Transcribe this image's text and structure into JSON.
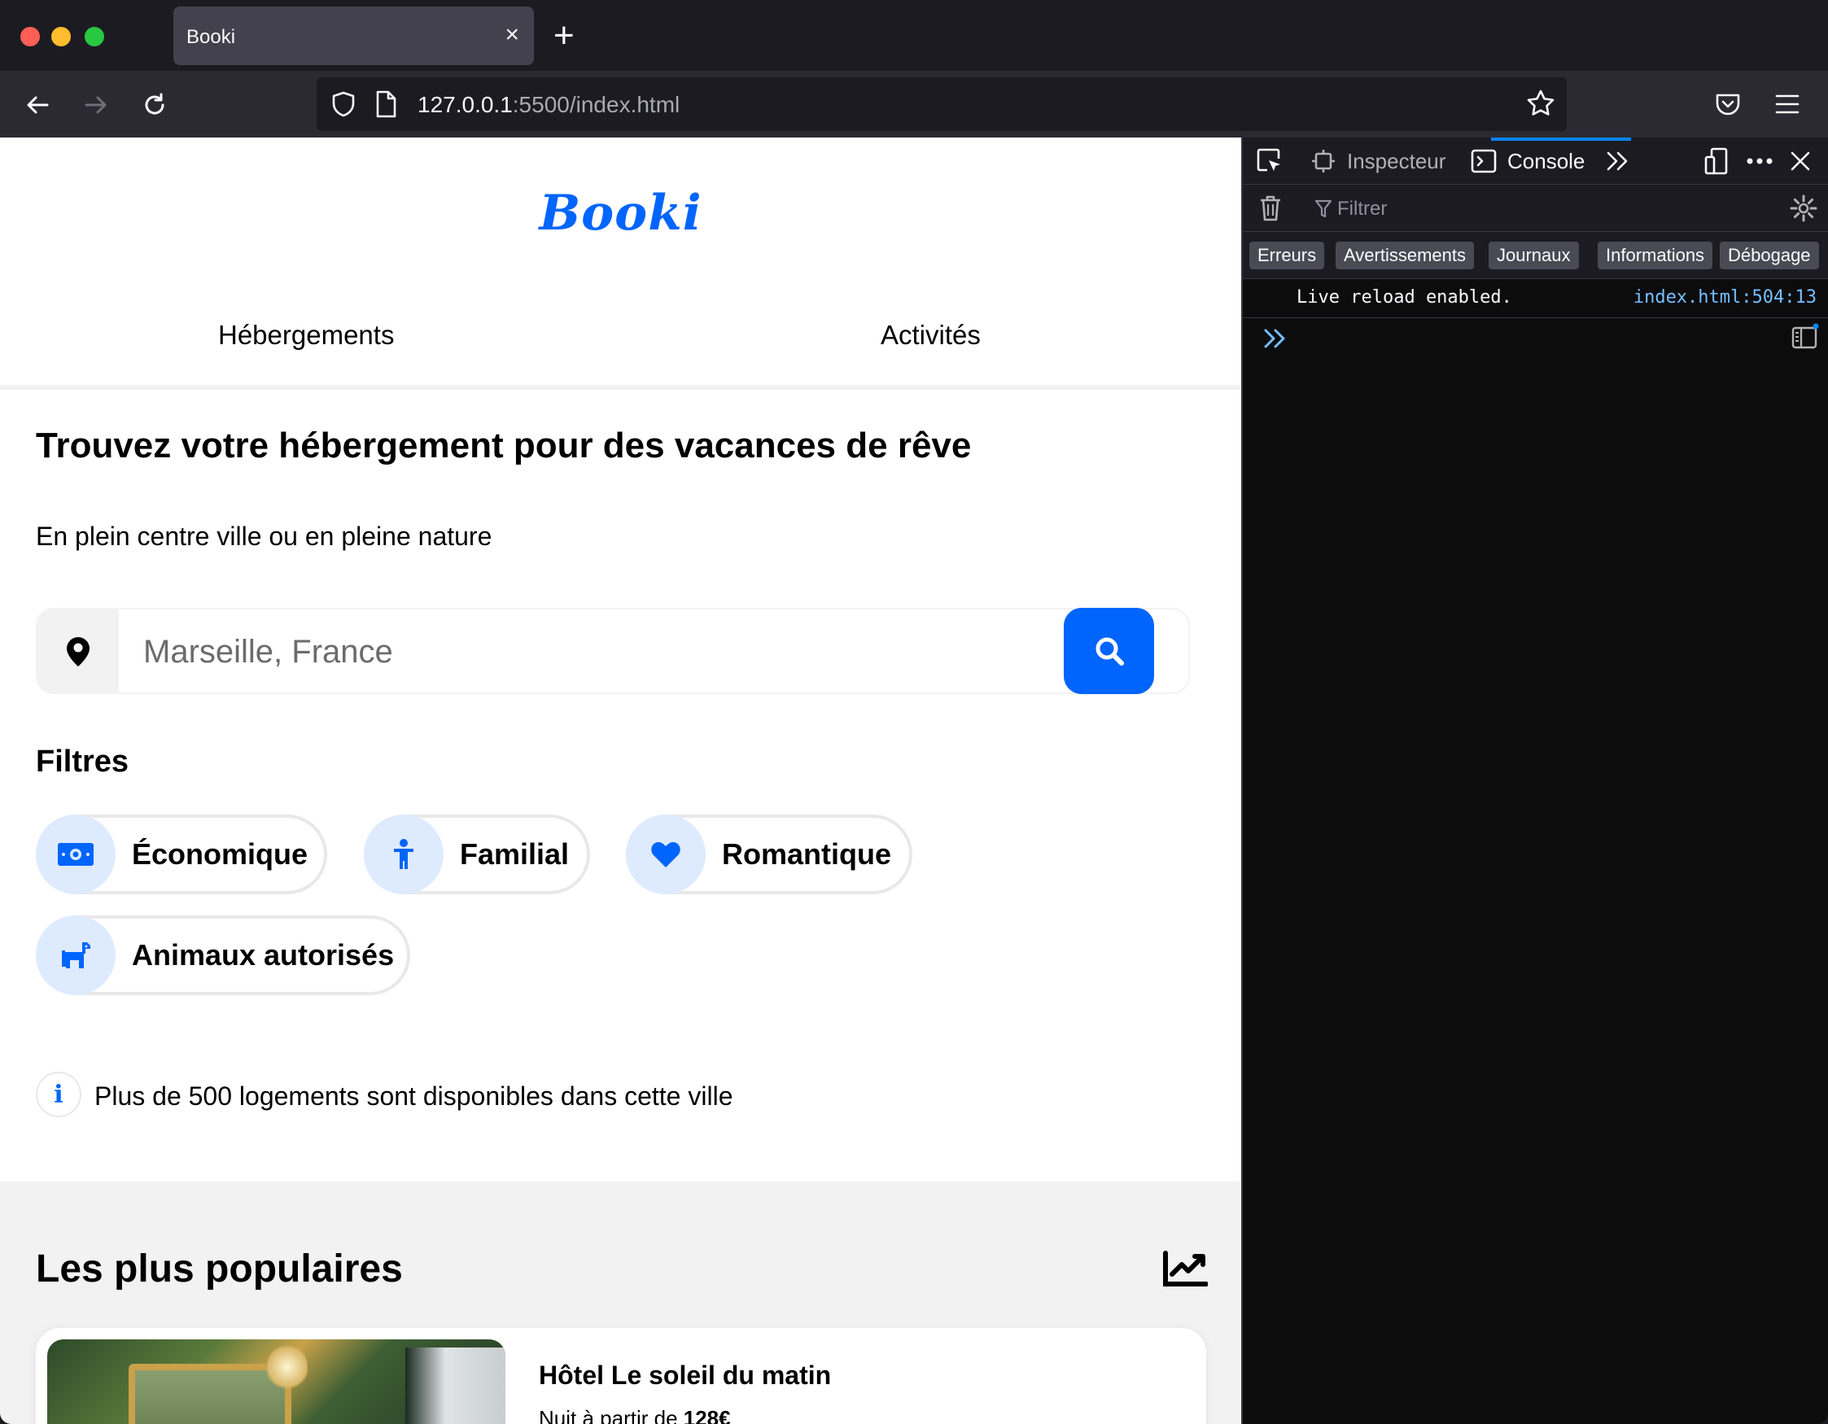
{
  "browser": {
    "tab_title": "Booki",
    "tab_close": "×",
    "new_tab": "+",
    "url_host": "127.0.0.1",
    "url_rest": ":5500/index.html"
  },
  "page": {
    "logo": "Booki",
    "nav": [
      {
        "label": "Hébergements"
      },
      {
        "label": "Activités"
      }
    ],
    "hero": {
      "title": "Trouvez votre hébergement pour des vacances de rêve",
      "subtitle": "En plein centre ville ou en pleine nature"
    },
    "search": {
      "placeholder": "Marseille, France",
      "value": ""
    },
    "filters": {
      "title": "Filtres",
      "items": [
        {
          "label": "Économique",
          "icon": "money-icon"
        },
        {
          "label": "Familial",
          "icon": "child-icon"
        },
        {
          "label": "Romantique",
          "icon": "heart-icon"
        },
        {
          "label": "Animaux autorisés",
          "icon": "dog-icon"
        }
      ]
    },
    "info": {
      "icon_glyph": "i",
      "text": "Plus de 500 logements sont disponibles dans cette ville"
    },
    "popular": {
      "title": "Les plus populaires",
      "card": {
        "title": "Hôtel Le soleil du matin",
        "price_prefix": "Nuit à partir de ",
        "price": "128€"
      }
    }
  },
  "devtools": {
    "tabs": [
      {
        "label": "Inspecteur"
      },
      {
        "label": "Console"
      }
    ],
    "filter_placeholder": "Filtrer",
    "levels": [
      {
        "label": "Erreurs"
      },
      {
        "label": "Avertissements"
      },
      {
        "label": "Journaux"
      },
      {
        "label": "Informations"
      },
      {
        "label": "Débogage"
      }
    ],
    "message": {
      "text": "Live reload enabled.",
      "source": "index.html:504:13"
    }
  },
  "colors": {
    "brand": "#0065fc",
    "chip_bg": "#deebff",
    "devtools_bg": "#0c0c0d",
    "link": "#75bfff"
  }
}
